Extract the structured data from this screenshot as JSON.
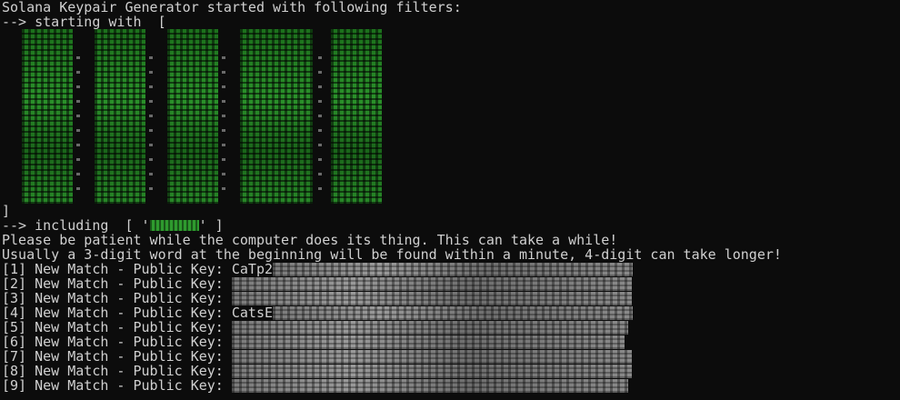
{
  "terminal": {
    "header_line": "Solana Keypair Generator started with following filters:",
    "starting_line": "--> starting with  [",
    "closing_bracket": "]",
    "including_prefix": "--> including  [ '",
    "including_suffix": "' ]",
    "patience_line": "Please be patient while the computer does its thing. This can take a while!",
    "hint_line": "Usually a 3-digit word at the beginning will be found within a minute, 4-digit can take longer!",
    "matches": [
      {
        "index": "[1]",
        "text": " New Match - Public Key: ",
        "visible_key": "CaTp2"
      },
      {
        "index": "[2]",
        "text": " New Match - Public Key: ",
        "visible_key": ""
      },
      {
        "index": "[3]",
        "text": " New Match - Public Key: ",
        "visible_key": ""
      },
      {
        "index": "[4]",
        "text": " New Match - Public Key: ",
        "visible_key": "CatsE"
      },
      {
        "index": "[5]",
        "text": " New Match - Public Key: ",
        "visible_key": ""
      },
      {
        "index": "[6]",
        "text": " New Match - Public Key: ",
        "visible_key": ""
      },
      {
        "index": "[7]",
        "text": " New Match - Public Key: ",
        "visible_key": ""
      },
      {
        "index": "[8]",
        "text": " New Match - Public Key: ",
        "visible_key": ""
      },
      {
        "index": "[9]",
        "text": " New Match - Public Key: ",
        "visible_key": ""
      }
    ]
  },
  "colors": {
    "background": "#0c0c0c",
    "text": "#d0d0d0",
    "accent_green": "#2fa12f"
  }
}
